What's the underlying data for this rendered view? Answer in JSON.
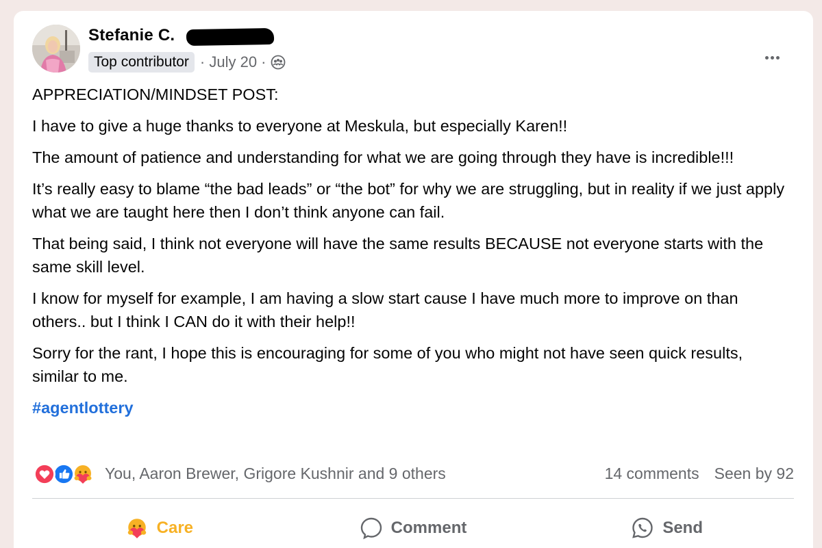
{
  "post": {
    "author_name": "Stefanie C.",
    "badge": "Top contributor",
    "meta": "· July 20 ·",
    "privacy_icon": "group-icon",
    "paragraphs": [
      "APPRECIATION/MINDSET POST:",
      "I have to give a huge thanks to everyone at Meskula, but especially Karen!!",
      "The amount of patience and understanding for what we are going through they have is incredible!!!",
      "It’s really easy to blame “the bad leads” or “the bot” for why we are struggling, but in reality if we just apply what we are taught here then I don’t think anyone can fail.",
      "That being said, I think not everyone will have the same results BECAUSE not everyone starts with the same skill level.",
      "I know for myself for example, I am having a slow start cause I have much more to improve on than others.. but I think I CAN do it with their help!!",
      "Sorry for the rant, I hope this is encouraging for some of you who might not have seen quick results, similar to me."
    ],
    "hashtag": "#agentlottery"
  },
  "reactions": {
    "icons": [
      "love-icon",
      "like-icon",
      "care-icon"
    ],
    "reactors": "You, Aaron Brewer, Grigore Kushnir and 9 others",
    "comments": "14 comments",
    "seen": "Seen by 92"
  },
  "actions": {
    "care_label": "Care",
    "comment_label": "Comment",
    "send_label": "Send"
  },
  "colors": {
    "background": "#f3e9e7",
    "link": "#216fdb",
    "care": "#f7b125",
    "love": "#f33e58",
    "like": "#1877f2",
    "muted": "#65676b"
  }
}
